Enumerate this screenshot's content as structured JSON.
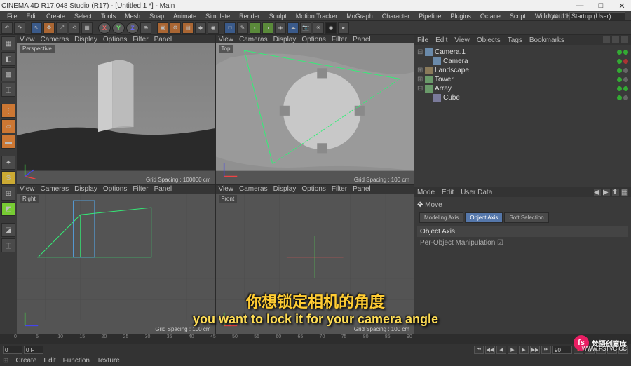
{
  "window": {
    "title": "CINEMA 4D R17.048 Studio (R17) - [Untitled 1 *] - Main",
    "min": "—",
    "max": "□",
    "close": "✕"
  },
  "menu": [
    "File",
    "Edit",
    "Create",
    "Select",
    "Tools",
    "Mesh",
    "Snap",
    "Animate",
    "Simulate",
    "Render",
    "Sculpt",
    "Motion Tracker",
    "MoGraph",
    "Character",
    "Pipeline",
    "Plugins",
    "Octane",
    "Script",
    "Window",
    "Help"
  ],
  "layout": {
    "label": "Layout:",
    "value": "Startup (User)"
  },
  "xyz": {
    "x": "X",
    "y": "Y",
    "z": "Z"
  },
  "vpmenu": [
    "View",
    "Cameras",
    "Display",
    "Options",
    "Filter",
    "Panel"
  ],
  "vp": {
    "tl": {
      "label": "Perspective",
      "foot": "Grid Spacing : 100000 cm"
    },
    "tr": {
      "label": "Top",
      "foot": "Grid Spacing : 100 cm"
    },
    "bl": {
      "label": "Right",
      "foot": "Grid Spacing : 100 cm"
    },
    "br": {
      "label": "Front",
      "foot": "Grid Spacing : 100 cm"
    }
  },
  "objPanel": {
    "tabs": [
      "File",
      "Edit",
      "View",
      "Objects",
      "Tags",
      "Bookmarks"
    ]
  },
  "tree": [
    {
      "exp": "⊟",
      "icon": "cam",
      "name": "Camera.1",
      "dots": [
        "g",
        "g"
      ],
      "indent": 0
    },
    {
      "exp": "",
      "icon": "cam",
      "name": "Camera",
      "dots": [
        "g",
        "r"
      ],
      "indent": 1
    },
    {
      "exp": "⊞",
      "icon": "land",
      "name": "Landscape",
      "dots": [
        "g",
        "gr"
      ],
      "indent": 0
    },
    {
      "exp": "⊞",
      "icon": "obj",
      "name": "Tower",
      "dots": [
        "g",
        "gr"
      ],
      "indent": 0
    },
    {
      "exp": "⊟",
      "icon": "obj",
      "name": "Array",
      "dots": [
        "g",
        "g"
      ],
      "indent": 0
    },
    {
      "exp": "",
      "icon": "cube",
      "name": "Cube",
      "dots": [
        "g",
        "gr"
      ],
      "indent": 1
    }
  ],
  "attr": {
    "tabs": [
      "Mode",
      "Edit",
      "User Data"
    ],
    "move": "Move",
    "btns": {
      "model": "Modeling Axis",
      "obj": "Object Axis",
      "soft": "Soft Selection"
    },
    "section": "Object Axis",
    "row": "Per-Object Manipulation ☑"
  },
  "timeline": {
    "start": "0",
    "cur": "0 F",
    "end": "90",
    "ticks": [
      0,
      5,
      10,
      15,
      20,
      25,
      30,
      35,
      40,
      45,
      50,
      55,
      60,
      65,
      70,
      75,
      80,
      85,
      90
    ]
  },
  "matbar": [
    "Create",
    "Edit",
    "Function",
    "Texture"
  ],
  "subtitle": {
    "cn": "你想锁定相机的角度",
    "en": "you want to lock it for your camera angle"
  },
  "wm": {
    "logo": "fs",
    "txt": "梵摄创意库",
    "url": "WWW.FSTVC.CC"
  }
}
